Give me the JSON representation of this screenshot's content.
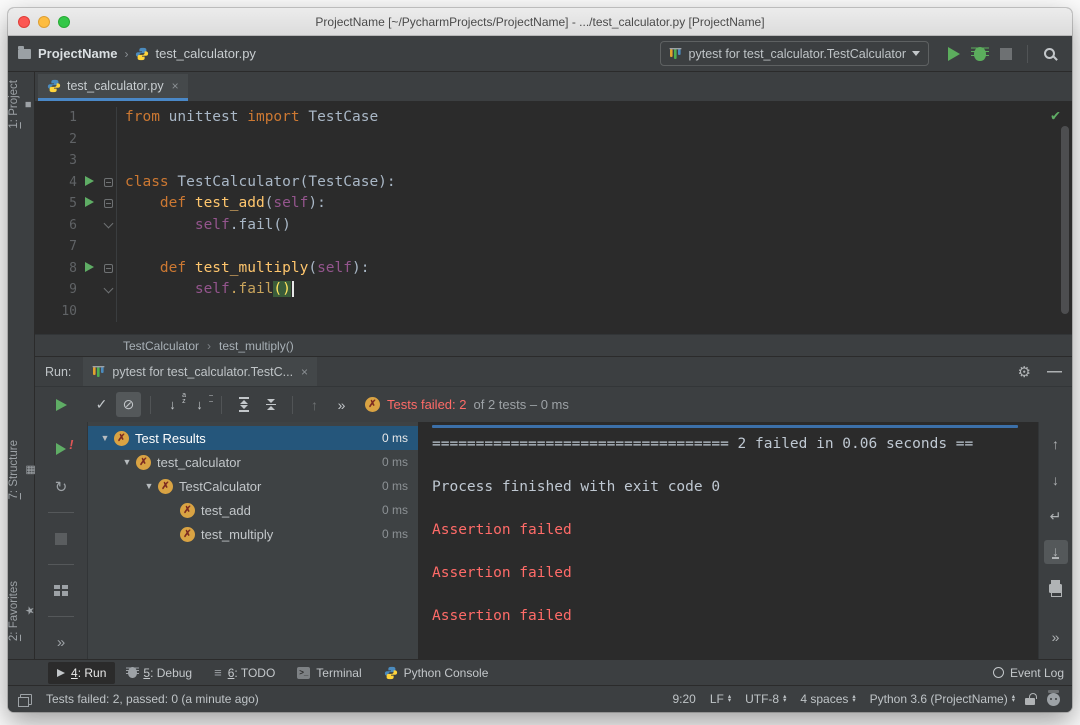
{
  "colors": {
    "editor_bg": "#2b2b2b",
    "panel_bg": "#3c3f41",
    "selection_blue": "#25567b",
    "tab_underline": "#4a88c7",
    "error_red": "#ff6b68",
    "run_green": "#5cad5d",
    "keyword_orange": "#cc7832",
    "function_yellow": "#ffc66d",
    "self_purple": "#94558d",
    "fail_icon_yellow": "#d9a343"
  },
  "window": {
    "title": "ProjectName [~/PycharmProjects/ProjectName] - .../test_calculator.py [ProjectName]"
  },
  "toolbar": {
    "project": "ProjectName",
    "file": "test_calculator.py",
    "crumb_sep": "›",
    "run_config": "pytest for test_calculator.TestCalculator"
  },
  "stripe": {
    "items": [
      {
        "mnemonic": "1",
        "rest": ": Project",
        "icon": "project-folder"
      },
      {
        "mnemonic": "7",
        "rest": ": Structure",
        "icon": "structure"
      },
      {
        "mnemonic": "2",
        "rest": ": Favorites",
        "icon": "star"
      }
    ]
  },
  "editor": {
    "tab": "test_calculator.py",
    "tab_close": "×",
    "run_lines": [
      4,
      5,
      8
    ],
    "fold": {
      "4": "open",
      "5": "open",
      "6": "end",
      "8": "open",
      "9": "end"
    },
    "lines": [
      [
        {
          "t": "from ",
          "c": "kw"
        },
        {
          "t": "unittest ",
          "c": "id"
        },
        {
          "t": "import ",
          "c": "kw"
        },
        {
          "t": "TestCase",
          "c": "id"
        }
      ],
      [],
      [],
      [
        {
          "t": "class ",
          "c": "kw"
        },
        {
          "t": "TestCalculator(TestCase):",
          "c": "id"
        }
      ],
      [
        {
          "t": "    ",
          "c": "id"
        },
        {
          "t": "def ",
          "c": "kw"
        },
        {
          "t": "test_add",
          "c": "fn"
        },
        {
          "t": "(",
          "c": "id"
        },
        {
          "t": "self",
          "c": "self"
        },
        {
          "t": "):",
          "c": "id"
        }
      ],
      [
        {
          "t": "        ",
          "c": "id"
        },
        {
          "t": "self",
          "c": "self"
        },
        {
          "t": ".fail()",
          "c": "id"
        }
      ],
      [],
      [
        {
          "t": "    ",
          "c": "id"
        },
        {
          "t": "def ",
          "c": "kw"
        },
        {
          "t": "test_multiply",
          "c": "fn"
        },
        {
          "t": "(",
          "c": "id"
        },
        {
          "t": "self",
          "c": "self"
        },
        {
          "t": "):",
          "c": "id"
        }
      ],
      [
        {
          "t": "        ",
          "c": "id"
        },
        {
          "t": "self",
          "c": "self"
        },
        {
          "t": ".fail",
          "c": "warm"
        },
        {
          "t": "(",
          "c": "hl"
        },
        {
          "t": ")",
          "c": "hl"
        },
        {
          "c": "caret"
        }
      ],
      []
    ],
    "breadcrumb": {
      "class": "TestCalculator",
      "sep": "›",
      "method": "test_multiply()"
    }
  },
  "run_panel": {
    "label": "Run:",
    "tab": "pytest for test_calculator.TestC...",
    "tab_close": "×",
    "status_failed": "Tests failed: 2",
    "status_rest": "of 2 tests – 0 ms",
    "tree": [
      {
        "label": "Test Results",
        "time": "0 ms",
        "indent": 0,
        "selected": true,
        "expand": true
      },
      {
        "label": "test_calculator",
        "time": "0 ms",
        "indent": 1,
        "selected": false,
        "expand": true
      },
      {
        "label": "TestCalculator",
        "time": "0 ms",
        "indent": 2,
        "selected": false,
        "expand": true
      },
      {
        "label": "test_add",
        "time": "0 ms",
        "indent": 3,
        "selected": false,
        "expand": false
      },
      {
        "label": "test_multiply",
        "time": "0 ms",
        "indent": 3,
        "selected": false,
        "expand": false
      }
    ],
    "console": {
      "lines": [
        {
          "t": "================================== 2 failed in 0.06 seconds ==",
          "cls": "plain"
        },
        {
          "t": "",
          "cls": "plain"
        },
        {
          "t": "Process finished with exit code 0",
          "cls": "plain"
        },
        {
          "t": "",
          "cls": "plain"
        },
        {
          "t": "Assertion failed",
          "cls": "err"
        },
        {
          "t": "",
          "cls": "plain"
        },
        {
          "t": "Assertion failed",
          "cls": "err"
        },
        {
          "t": "",
          "cls": "plain"
        },
        {
          "t": "Assertion failed",
          "cls": "err"
        }
      ]
    }
  },
  "bottom_bar": {
    "tabs": [
      {
        "icon": "run",
        "mnemonic": "4",
        "rest": ": Run",
        "active": true
      },
      {
        "icon": "debug",
        "mnemonic": "5",
        "rest": ": Debug",
        "active": false
      },
      {
        "icon": "todo",
        "mnemonic": "6",
        "rest": ": TODO",
        "active": false
      },
      {
        "icon": "terminal",
        "mnemonic": "",
        "rest": "Terminal",
        "active": false
      },
      {
        "icon": "python",
        "mnemonic": "",
        "rest": "Python Console",
        "active": false
      }
    ],
    "event_log": "Event Log"
  },
  "status_bar": {
    "message": "Tests failed: 2, passed: 0 (a minute ago)",
    "items": [
      {
        "label": "9:20",
        "arrows": false
      },
      {
        "label": "LF",
        "arrows": true
      },
      {
        "label": "UTF-8",
        "arrows": true
      },
      {
        "label": "4 spaces",
        "arrows": true
      },
      {
        "label": "Python 3.6 (ProjectName)",
        "arrows": true
      }
    ]
  }
}
